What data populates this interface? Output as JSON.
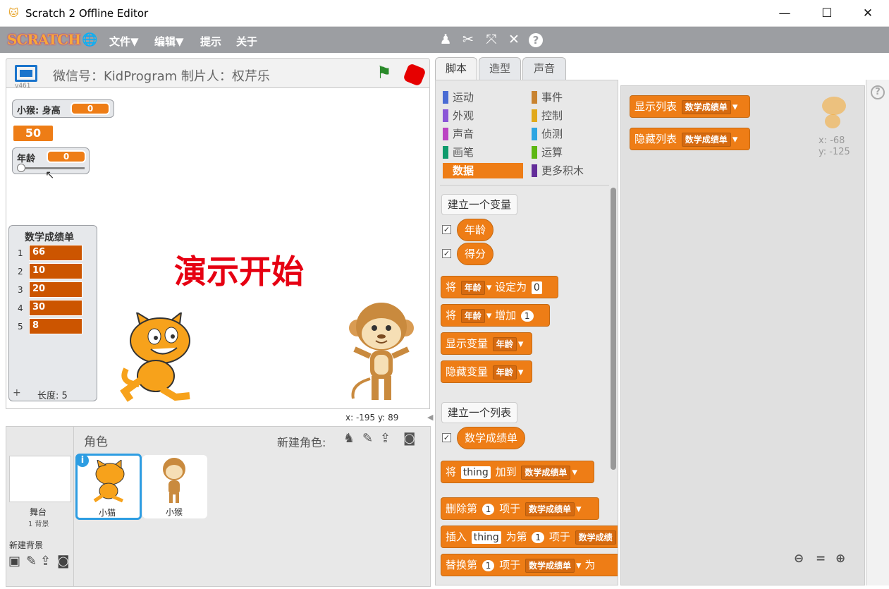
{
  "window": {
    "title": "Scratch 2 Offline Editor",
    "minimize": "—",
    "maximize": "☐",
    "close": "✕"
  },
  "menubar": {
    "logo": "SCRATCH",
    "items": [
      "文件▼",
      "编辑▼",
      "提示",
      "关于"
    ],
    "tools": [
      "copy-tool-icon",
      "cut-tool-icon",
      "grow-tool-icon",
      "shrink-tool-icon",
      "help-tool-icon"
    ]
  },
  "stage": {
    "title": "微信号：KidProgram  制片人：权芹乐",
    "version": "v461",
    "center_text": "演示开始",
    "coords": "x: -195  y: 89",
    "monitors": {
      "height_label": "小猴: 身高",
      "height_value": "0",
      "large_value": "50",
      "age_label": "年龄",
      "age_value": "0"
    },
    "list": {
      "title": "数学成绩单",
      "items": [
        "66",
        "10",
        "20",
        "30",
        "8"
      ],
      "length_label": "长度: 5",
      "add": "+"
    }
  },
  "sprites": {
    "header": "角色",
    "new_sprite_label": "新建角色:",
    "stage_label": "舞台",
    "stage_sub": "1 背景",
    "new_backdrop_label": "新建背景",
    "items": [
      {
        "name": "小猫"
      },
      {
        "name": "小猴"
      }
    ]
  },
  "tabs": [
    "脚本",
    "造型",
    "声音"
  ],
  "palette": {
    "categories_left": [
      {
        "label": "运动",
        "color": "#4a6cd4"
      },
      {
        "label": "外观",
        "color": "#8a55d7"
      },
      {
        "label": "声音",
        "color": "#bb42c3"
      },
      {
        "label": "画笔",
        "color": "#0e9a6c"
      },
      {
        "label": "数据",
        "color": "#ee7d16"
      }
    ],
    "categories_right": [
      {
        "label": "事件",
        "color": "#c88330"
      },
      {
        "label": "控制",
        "color": "#e1a91a"
      },
      {
        "label": "侦测",
        "color": "#2ca5e2"
      },
      {
        "label": "运算",
        "color": "#5cb712"
      },
      {
        "label": "更多积木",
        "color": "#632d99"
      }
    ],
    "make_variable": "建立一个变量",
    "var1": "年龄",
    "var2": "得分",
    "set_prefix": "将",
    "set_var": "年龄",
    "set_mid": "设定为",
    "set_val": "0",
    "change_prefix": "将",
    "change_var": "年龄",
    "change_mid": "增加",
    "change_val": "1",
    "show_var": "显示变量",
    "show_var_dd": "年龄",
    "hide_var": "隐藏变量",
    "hide_var_dd": "年龄",
    "make_list": "建立一个列表",
    "list_name": "数学成绩单",
    "add_prefix": "将",
    "add_thing": "thing",
    "add_mid": "加到",
    "add_list": "数学成绩单",
    "del_prefix": "删除第",
    "del_idx": "1",
    "del_mid": "项于",
    "del_list": "数学成绩单",
    "ins_prefix": "插入",
    "ins_thing": "thing",
    "ins_mid": "为第",
    "ins_idx": "1",
    "ins_mid2": "项于",
    "ins_list": "数学成绩",
    "rep_prefix": "替换第",
    "rep_idx": "1",
    "rep_mid": "项于",
    "rep_list": "数学成绩单",
    "rep_suffix": "为"
  },
  "scripts": {
    "show_list": "显示列表",
    "show_list_dd": "数学成绩单",
    "hide_list": "隐藏列表",
    "hide_list_dd": "数学成绩单",
    "sprite_x": "x: -68",
    "sprite_y": "y: -125"
  }
}
